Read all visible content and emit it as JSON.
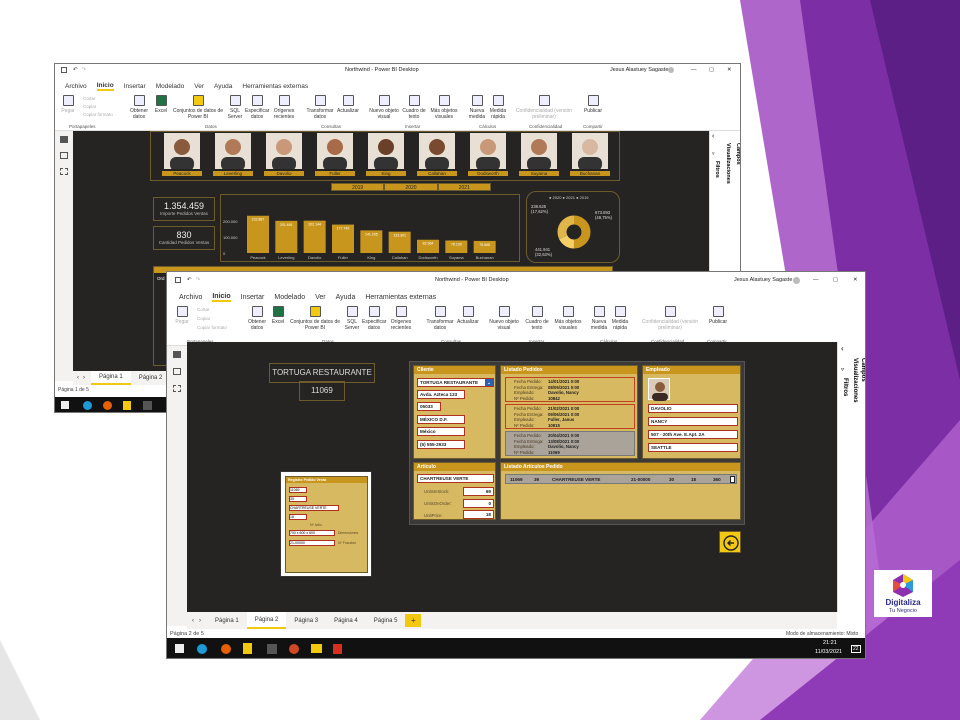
{
  "window1": {
    "title": "Northwind - Power BI Desktop",
    "user": "Jesus Alastuey Sagaste",
    "menu": [
      "Archivo",
      "Inicio",
      "Insertar",
      "Modelado",
      "Ver",
      "Ayuda",
      "Herramientas externas"
    ],
    "ribbon": {
      "pegar": "Pegar",
      "cortar": "Cortar",
      "copiar": "Copiar",
      "copiar_formato": "Copiar formato",
      "obtener_datos": "Obtener datos",
      "excel": "Excel",
      "conjuntos": "Conjuntos de datos de Power BI",
      "sql": "SQL Server",
      "especificar": "Especificar datos",
      "origenes": "Orígenes recientes",
      "transformar": "Transformar datos",
      "actualizar": "Actualizar",
      "nuevo_objeto": "Nuevo objeto visual",
      "cuadro_texto": "Cuadro de texto",
      "mas_objetos": "Más objetos visuales",
      "nueva_medida": "Nueva medida",
      "medida_rapida": "Medida rápida",
      "confidencialidad": "Confidencialidad (versión preliminar)",
      "publicar": "Publicar",
      "grupos": [
        "Portapapeles",
        "Datos",
        "Consultas",
        "Insertar",
        "Cálculos",
        "Confidencialidad",
        "Compartir"
      ]
    },
    "employees": [
      "Peacock",
      "Leverling",
      "Davolio",
      "Fuller",
      "King",
      "Callahan",
      "Dodsworth",
      "Suyama",
      "Buchanan"
    ],
    "years": [
      "2019",
      "2020",
      "2021"
    ],
    "kpi1": {
      "value": "1.354.459",
      "label": "Importe Pedidos Ventas"
    },
    "kpi2": {
      "value": "830",
      "label": "Cantidad Pedidos Ventas"
    },
    "donut": {
      "legend": [
        "2020",
        "2021",
        "2019"
      ],
      "label_a": "238.625",
      "label_a2": "(17,62%)",
      "label_b": "673.893",
      "label_b2": "(49,75%)",
      "label_c": "441.941",
      "label_c2": "(32,63%)",
      "colors": [
        "#c8961d",
        "#f5cf65",
        "#7a6a40"
      ]
    },
    "right_panes": {
      "filtros": "Filtros",
      "visualizaciones": "Visualizaciones",
      "campos": "Campos"
    },
    "tabs": [
      "Página 1",
      "Página 2"
    ],
    "status": "Página 1 de 5",
    "truncated_title": "Ord"
  },
  "chart_data": {
    "type": "bar",
    "categories": [
      "Peacock",
      "Leverling",
      "Davolio",
      "Fuller",
      "King",
      "Callahan",
      "Dodsworth",
      "Suyama",
      "Buchanan"
    ],
    "values": [
      232.89,
      201.2,
      202.14,
      177.75,
      141.3,
      133.3,
      82.96,
      78.2,
      75.57
    ],
    "value_labels": [
      "232.887",
      "201.691",
      "202.144",
      "177.749",
      "141.295",
      "133.301",
      "82.964",
      "78.199",
      "75.568"
    ],
    "ytick_labels": [
      "200.000",
      "100.000",
      "0"
    ],
    "ylim": [
      0,
      300
    ]
  },
  "window2": {
    "title": "Northwind - Power BI Desktop",
    "user": "Jesus Alastuey Sagaste",
    "menu": [
      "Archivo",
      "Inicio",
      "Insertar",
      "Modelado",
      "Ver",
      "Ayuda",
      "Herramientas externas"
    ],
    "header_name": "TORTUGA RESTAURANTE",
    "header_id": "11069",
    "cliente": {
      "title": "Cliente",
      "name": "TORTUGA RESTAURANTE",
      "address": "Avda. Azteca 123",
      "zip": "05033",
      "city": "MÉXICO D.F.",
      "country": "México",
      "phone": "(5) 555-2933"
    },
    "pedidos": {
      "title": "Listado Pedidos",
      "labels": [
        "Fecha Pedido:",
        "Fecha Entrega:",
        "Empleado:",
        "Nº Pedido:"
      ],
      "items": [
        {
          "fp": "14/01/2021 0:00",
          "fe": "08/05/2021 0:00",
          "emp": "Davolio, Nancy",
          "num": "10842"
        },
        {
          "fp": "21/02/2021 0:00",
          "fe": "09/06/2021 0:00",
          "emp": "Fuller, Janus",
          "num": "10915"
        },
        {
          "fp": "20/04/2021 0:00",
          "fe": "13/08/2021 0:00",
          "emp": "Davolio, Nancy",
          "num": "11069"
        }
      ]
    },
    "empleado": {
      "title": "Empleado",
      "first": "DAVOLIO",
      "last": "NANCY",
      "address": "507 - 20th Ave. E.Apt. 2A",
      "city": "SEATTLE"
    },
    "articulo": {
      "title": "Artículo",
      "name": "CHARTREUSE VERTE",
      "l1": "UnitsInStock:",
      "v1": "69",
      "l2": "UnitsOnOrder:",
      "v2": "0",
      "l3": "UnitPrice:",
      "v3": "18"
    },
    "listado_articulos": {
      "title": "Listado Artículos Pedido",
      "row": {
        "c1": "11069",
        "c2": "39",
        "c3": "CHARTREUSE VERTE",
        "c4": "21-00000",
        "c5": "30",
        "c6": "18",
        "c7": "360"
      }
    },
    "mini": {
      "title": "Registro Pedido Venta",
      "f1": "11069",
      "f2": "39",
      "f3": "CHARTREUSE VERTE",
      "f4": "18",
      "f5": "700 x 600 x 600",
      "f6": "21-00000",
      "l4": "Nº Artíc.",
      "l5": "Dimensiones",
      "l6": "Nº Fracción"
    },
    "right_panes": {
      "filtros": "Filtros",
      "visualizaciones": "Visualizaciones",
      "campos": "Campos"
    },
    "tabs": [
      "Página 1",
      "Página 2",
      "Página 3",
      "Página 4",
      "Página 5"
    ],
    "add_tab": "+",
    "status": "Página 2 de 5",
    "storage": "Modo de almacenamiento: Mixto",
    "time": "21:21",
    "date": "11/03/2021",
    "badge": "22"
  },
  "brand": {
    "line1": "Digitaliza",
    "line2": "Tu Negocio"
  }
}
